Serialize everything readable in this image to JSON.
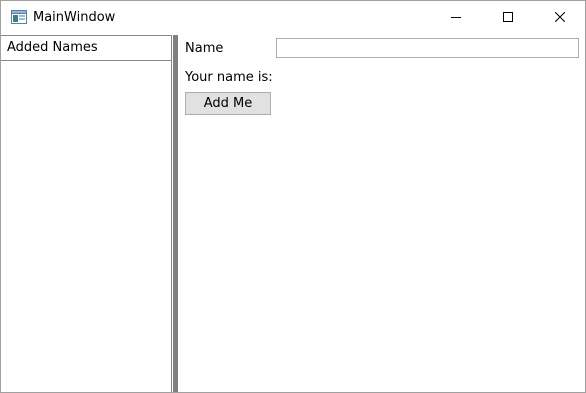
{
  "window": {
    "title": "MainWindow",
    "app_icon": "window-app-icon",
    "controls": {
      "minimize_icon": "minimize-icon",
      "maximize_icon": "maximize-icon",
      "close_icon": "close-icon"
    }
  },
  "left_panel": {
    "list_header": "Added Names",
    "items": []
  },
  "form": {
    "name_label": "Name",
    "name_value": "",
    "your_name_label": "Your name is:",
    "add_button_label": "Add Me"
  },
  "colors": {
    "splitter": "#808080",
    "button_face": "#e1e1e1",
    "border": "#828790"
  }
}
